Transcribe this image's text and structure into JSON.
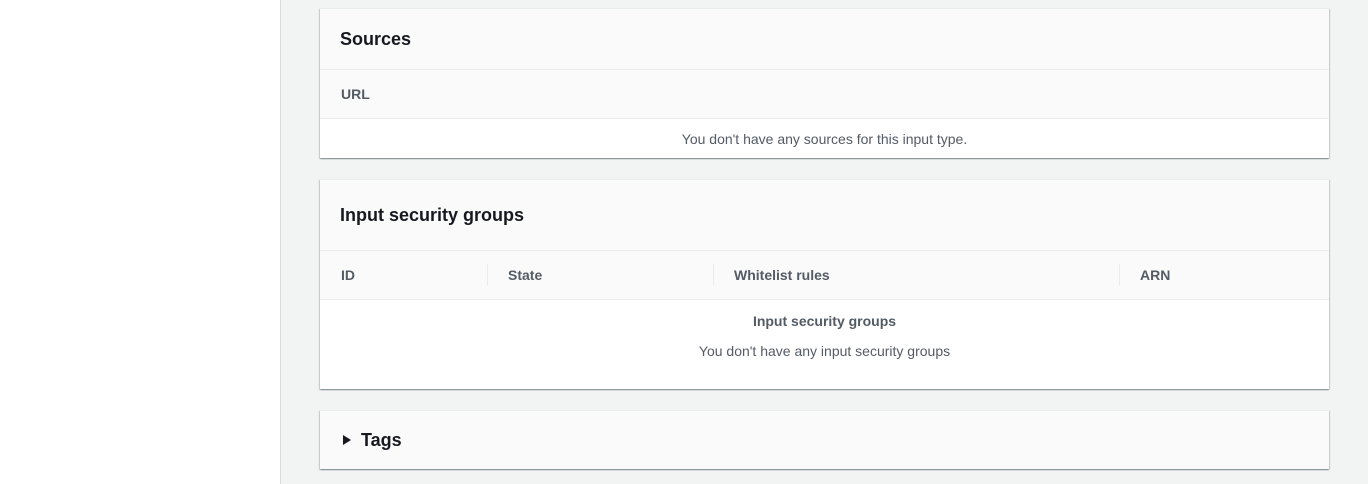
{
  "sources": {
    "title": "Sources",
    "columns": [
      "URL"
    ],
    "empty_text": "You don't have any sources for this input type."
  },
  "security_groups": {
    "title": "Input security groups",
    "columns": [
      "ID",
      "State",
      "Whitelist rules",
      "ARN"
    ],
    "empty_title": "Input security groups",
    "empty_text": "You don't have any input security groups"
  },
  "tags": {
    "title": "Tags"
  }
}
